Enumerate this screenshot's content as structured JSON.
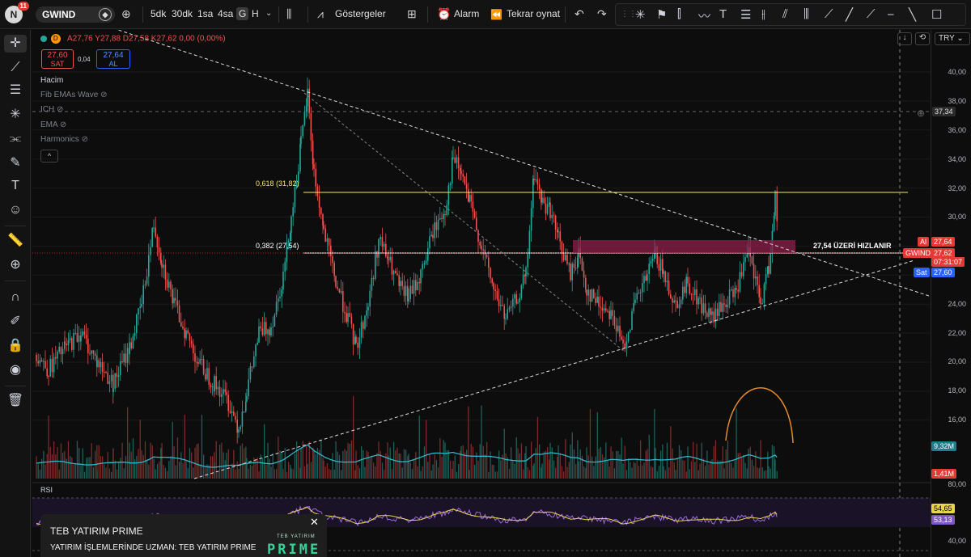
{
  "topbar": {
    "notif_letter": "N",
    "notif_count": "11",
    "symbol": "GWIND",
    "intervals": [
      "5dk",
      "30dk",
      "1sa",
      "4sa",
      "G",
      "H"
    ],
    "selected_interval": "G",
    "indicators_label": "Göstergeler",
    "alarm_label": "Alarm",
    "replay_label": "Tekrar oynat"
  },
  "legend": {
    "timeframe": "D",
    "ohlc_text": "A27,76  Y27,88  D27,58  K27,62  0,00 (0,00%)",
    "sell_price": "27,60",
    "sell_label": "SAT",
    "spread": "0,04",
    "buy_price": "27,64",
    "buy_label": "AL",
    "volume_label": "Hacim",
    "indicators": [
      "Fib EMAs Wave",
      "ICH",
      "EMA",
      "Harmonics"
    ]
  },
  "right_controls": {
    "currency": "TRY"
  },
  "axis": {
    "ticks": [
      "40,00",
      "38,00",
      "36,00",
      "34,00",
      "32,00",
      "30,00",
      "24,00",
      "22,00",
      "20,00",
      "18,00",
      "16,00",
      "80,00",
      "40,00"
    ],
    "crosshair_price": "37,34",
    "vol_ma": "9,32M",
    "vol": "1,41M",
    "rsi_a": "54,65",
    "rsi_b": "53,13"
  },
  "tags": {
    "al_label": "Al",
    "al_price": "27,64",
    "symbol_tag": "GWIND",
    "last_price": "27,62",
    "countdown": "07:31:07",
    "sat_label": "Sat",
    "sat_price": "27,60"
  },
  "annotations": {
    "fib_618": "0,618 (31,82)",
    "fib_382": "0,382 (27,54)",
    "note": "27,54 ÜZERİ HIZLANIR",
    "rsi_label": "RSI"
  },
  "toast": {
    "title": "TEB YATIRIM PRIME",
    "subtitle": "YATIRIM İŞLEMLERİNDE UZMAN: TEB YATIRIM PRIME",
    "logo_small": "TEB YATIRIM",
    "logo_big": "PRIME"
  },
  "colors": {
    "up": "#26a69a",
    "down": "#ef5350",
    "fib": "#f5e663",
    "zone": "#8e1d4a",
    "rsi": "#9c6ade",
    "rsi_ma": "#e8d44d",
    "vol_ma": "#2fb7c9",
    "arc": "#e58a2b"
  }
}
